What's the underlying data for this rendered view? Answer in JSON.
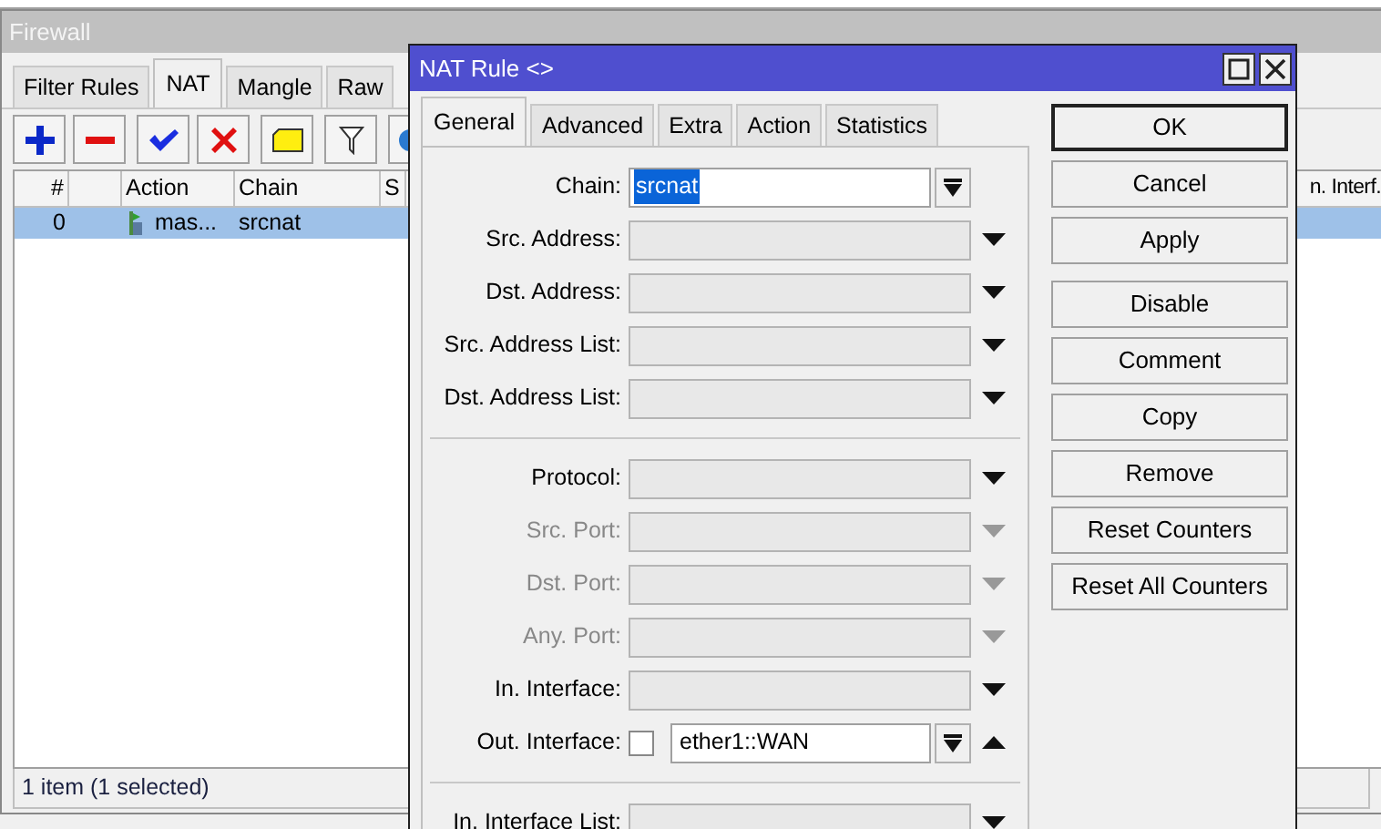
{
  "firewall": {
    "title": "Firewall",
    "tabs": [
      {
        "label": "Filter Rules",
        "selected": false
      },
      {
        "label": "NAT",
        "selected": true
      },
      {
        "label": "Mangle",
        "selected": false
      },
      {
        "label": "Raw",
        "selected": false
      }
    ],
    "columns": [
      "#",
      "Action",
      "Chain",
      "S",
      "n. Interf."
    ],
    "rows": [
      {
        "number": "0",
        "action": "mas...",
        "chain": "srcnat",
        "selected": true
      }
    ],
    "status": "1 item (1 selected)"
  },
  "dialog": {
    "title": "NAT Rule <>",
    "tabs": [
      {
        "label": "General",
        "selected": true
      },
      {
        "label": "Advanced",
        "selected": false
      },
      {
        "label": "Extra",
        "selected": false
      },
      {
        "label": "Action",
        "selected": false
      },
      {
        "label": "Statistics",
        "selected": false
      }
    ],
    "field_groups": [
      [
        {
          "kind": "combo",
          "label": "Chain:",
          "value": "srcnat",
          "disabled": false
        },
        {
          "kind": "dropdown",
          "label": "Src. Address:",
          "disabled": false
        },
        {
          "kind": "dropdown",
          "label": "Dst. Address:",
          "disabled": false
        },
        {
          "kind": "dropdown",
          "label": "Src. Address List:",
          "disabled": false
        },
        {
          "kind": "dropdown",
          "label": "Dst. Address List:",
          "disabled": false
        }
      ],
      [
        {
          "kind": "dropdown",
          "label": "Protocol:",
          "disabled": false
        },
        {
          "kind": "dropdown",
          "label": "Src. Port:",
          "disabled": true
        },
        {
          "kind": "dropdown",
          "label": "Dst. Port:",
          "disabled": true
        },
        {
          "kind": "dropdown",
          "label": "Any. Port:",
          "disabled": true
        },
        {
          "kind": "dropdown",
          "label": "In. Interface:",
          "disabled": false
        },
        {
          "kind": "negatable",
          "label": "Out. Interface:",
          "value": "ether1::WAN",
          "checked": false,
          "disabled": false
        }
      ],
      [
        {
          "kind": "dropdown",
          "label": "In. Interface List:",
          "disabled": false
        }
      ]
    ],
    "buttons": [
      {
        "label": "OK",
        "default": true
      },
      {
        "label": "Cancel",
        "default": false
      },
      {
        "label": "Apply",
        "default": false
      },
      {
        "label": "Disable",
        "default": false
      },
      {
        "label": "Comment",
        "default": false
      },
      {
        "label": "Copy",
        "default": false
      },
      {
        "label": "Remove",
        "default": false
      },
      {
        "label": "Reset Counters",
        "default": false
      },
      {
        "label": "Reset All Counters",
        "default": false
      }
    ]
  }
}
